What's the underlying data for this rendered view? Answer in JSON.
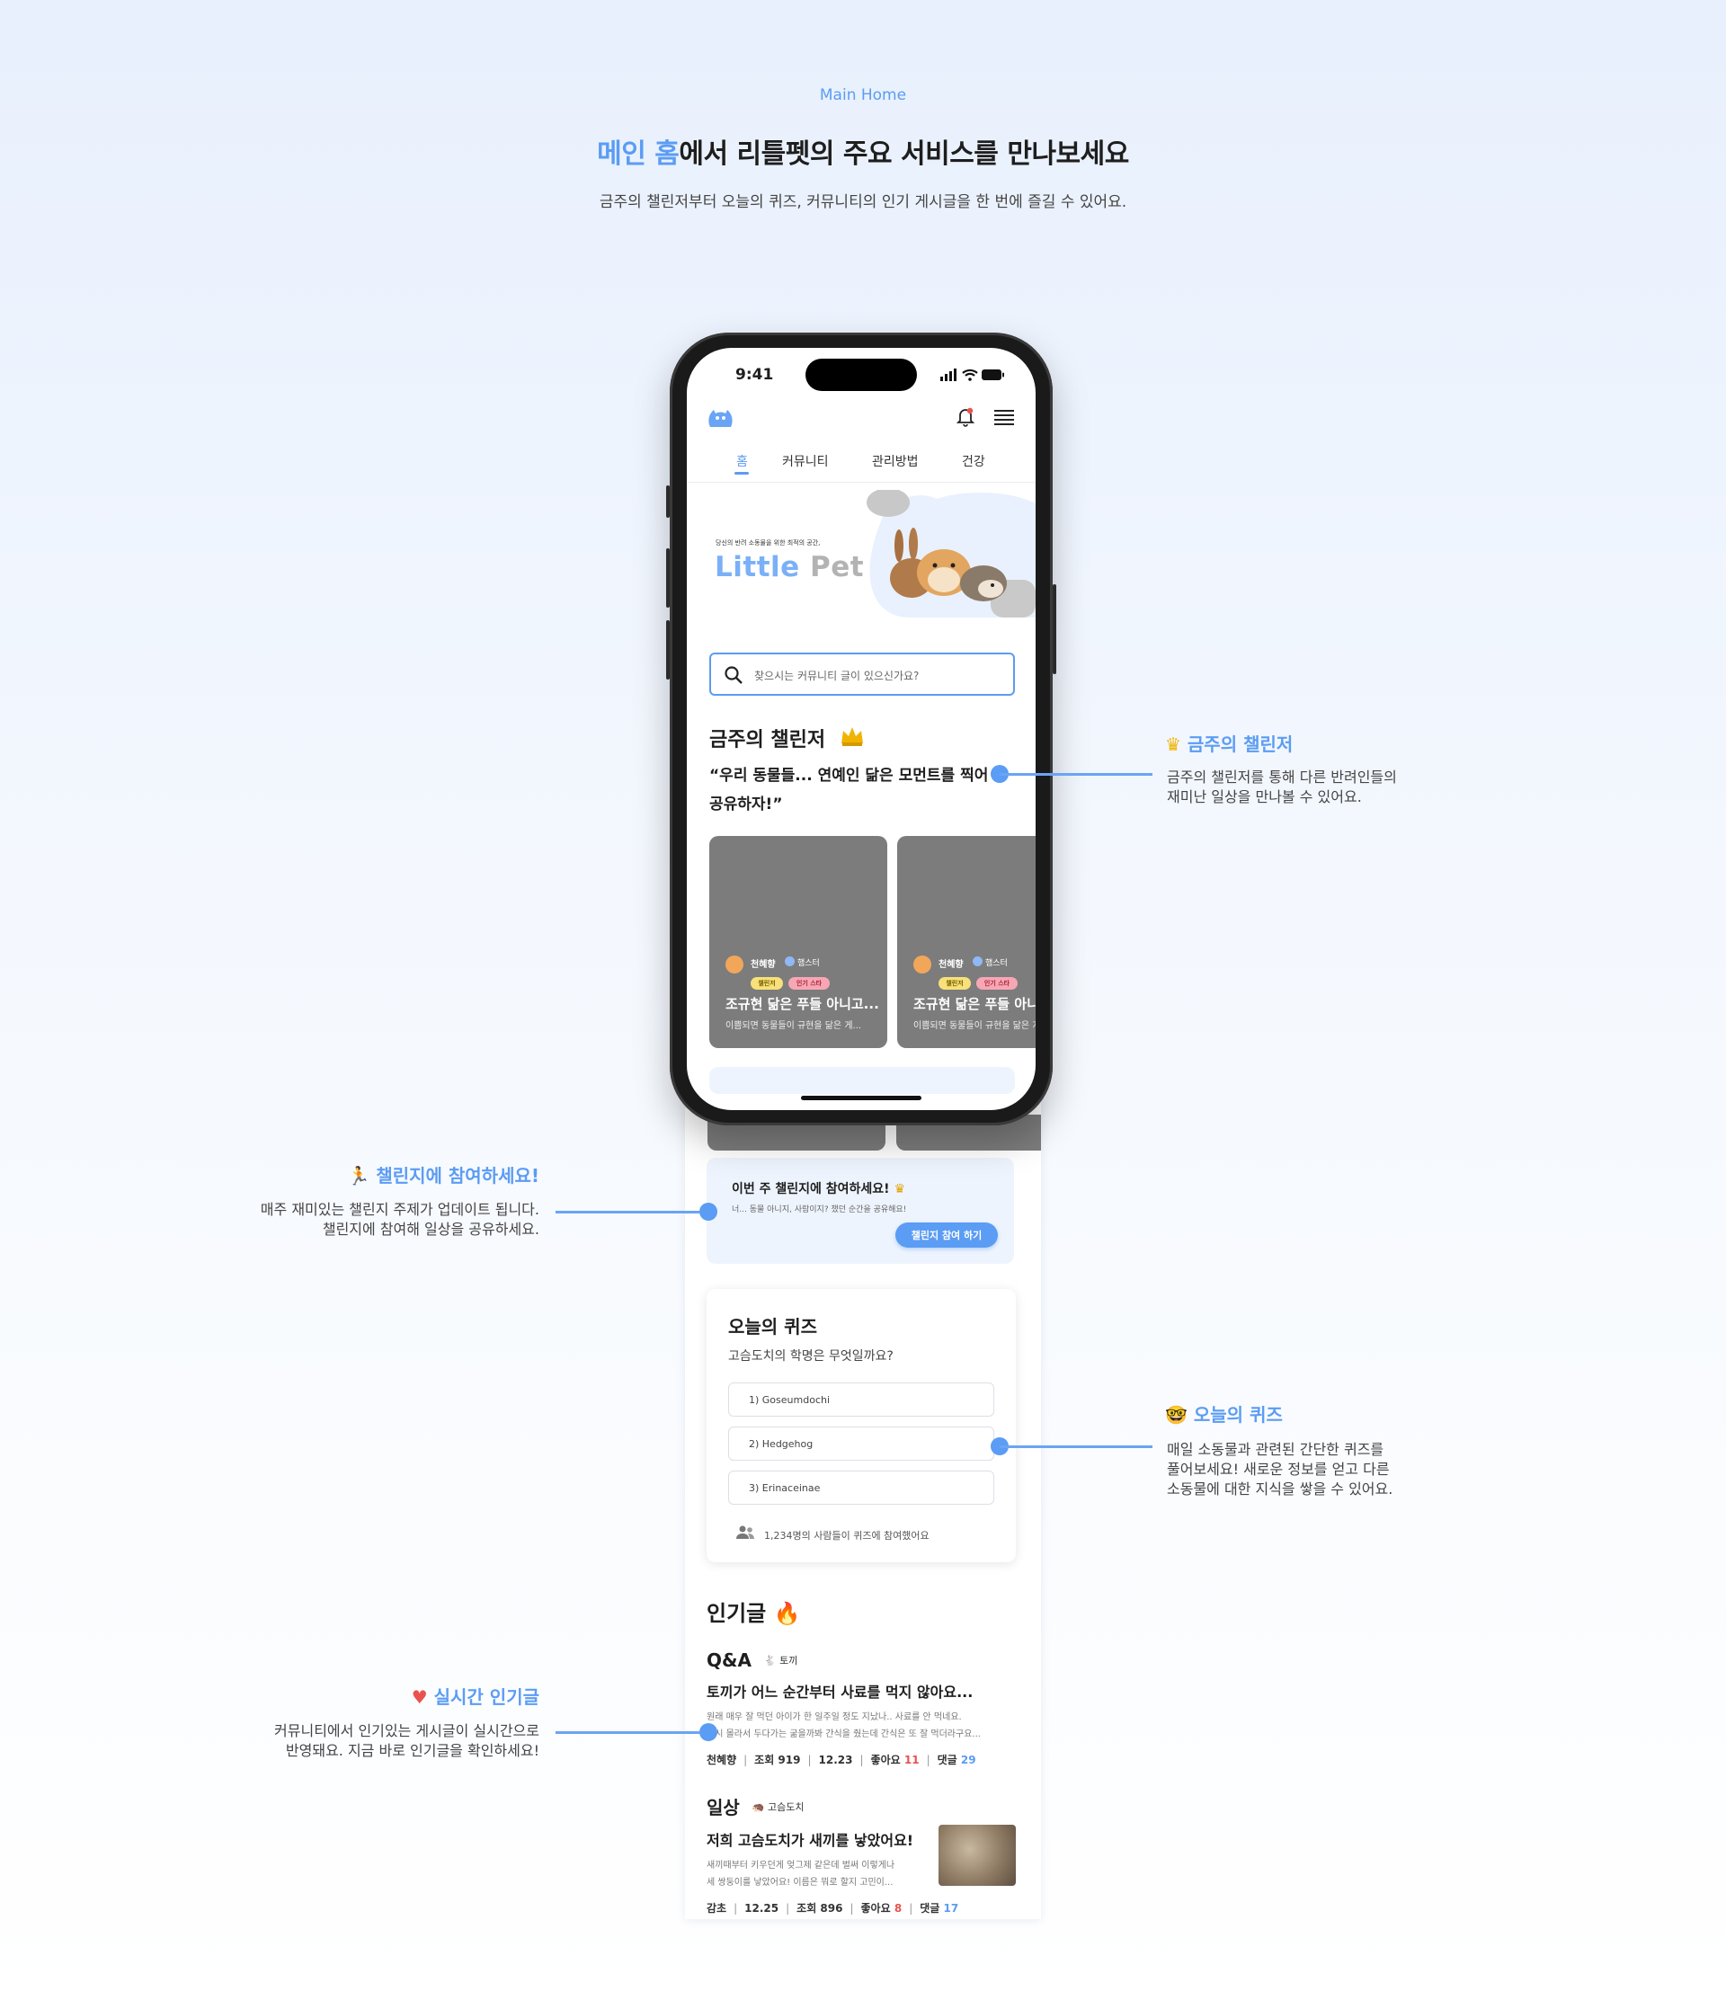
{
  "header": {
    "eyebrow": "Main Home",
    "headline_highlight": "메인 홈",
    "headline_rest": "에서 리틀펫의 주요 서비스를 만나보세요",
    "subline": "금주의 챌린저부터 오늘의 퀴즈, 커뮤니티의 인기 게시글을 한 번에 즐길 수 있어요."
  },
  "status_bar": {
    "time": "9:41"
  },
  "tabs": [
    {
      "label": "홈",
      "active": true
    },
    {
      "label": "커뮤니티",
      "active": false
    },
    {
      "label": "관리방법",
      "active": false
    },
    {
      "label": "건강",
      "active": false
    }
  ],
  "hero": {
    "tagline": "당신의 반려 소동물을 위한 최적의 공간,",
    "logo_part1": "Little",
    "logo_part2": "Pet"
  },
  "search": {
    "placeholder": "찾으시는 커뮤니티 글이 있으신가요?"
  },
  "challenger": {
    "title": "금주의 챌린저",
    "quote": "“우리 동물들... 연예인 닮은 모먼트를 찍어 공유하자!”",
    "cards": [
      {
        "author": "천혜향",
        "species": "햄스터",
        "badge1": "챌린저",
        "badge2": "인기 스타",
        "title": "조규현 닮은 푸들 아니고...",
        "snippet": "이쁨되면 동물들이 규현을 닮은 게..."
      },
      {
        "author": "천혜향",
        "species": "햄스터",
        "badge1": "챌린저",
        "badge2": "인기 스타",
        "title": "조규현 닮은 푸들 아니고...",
        "snippet": "이쁨되면 동물들이 규현을 닮은 게..."
      }
    ]
  },
  "challenge_cta": {
    "title": "이번 주 챌린지에 참여하세요!",
    "subtitle": "너... 동물 아니지, 사람이지? 챘던 순간을 공유해요!",
    "button": "챌린지 참여 하기"
  },
  "quiz": {
    "title": "오늘의 퀴즈",
    "question": "고슴도치의 학명은 무엇일까요?",
    "options": [
      "1) Goseumdochi",
      "2) Hedgehog",
      "3) Erinaceinae"
    ],
    "participants": "1,234명의 사람들이 퀴즈에 참여했어요"
  },
  "popular": {
    "title": "인기글",
    "posts": [
      {
        "category": "Q&A",
        "tag": "토끼",
        "title": "토끼가 어느 순간부터 사료를 먹지 않아요...",
        "body1": "원래 매우 잘 먹던 아이가 한 일주일 정도 지났나.. 사료를 안 먹네요.",
        "body2": "혹시 몰라서 두다가는 굶을까봐 간식을 줬는데 간식은 또 잘 먹더라구요...",
        "author": "천혜향",
        "views": "조회 919",
        "date": "12.23",
        "likes_label": "좋아요",
        "likes": "11",
        "comments_label": "댓글",
        "comments": "29"
      },
      {
        "category": "일상",
        "tag": "고슴도치",
        "title": "저희 고슴도치가 새끼를 낳았어요!",
        "body1": "새끼때부터 키우던게 엊그제 같은데 벌써 이렇게나",
        "body2": "세 쌍둥이를 낳았어요! 이름은 뭐로 할지 고민이...",
        "author": "감초",
        "date": "12.25",
        "views": "조회 896",
        "likes_label": "좋아요",
        "likes": "8",
        "comments_label": "댓글",
        "comments": "17"
      }
    ]
  },
  "annotations": {
    "challenger": {
      "title": "금주의 챌린저",
      "desc1": "금주의 챌린저를 통해 다른 반려인들의",
      "desc2": "재미난 일상을 만나볼 수 있어요."
    },
    "join": {
      "title": "챌린지에 참여하세요!",
      "desc1": "매주 재미있는 챌린지 주제가 업데이트 됩니다.",
      "desc2": "챌린지에 참여해 일상을 공유하세요."
    },
    "quiz": {
      "title": "오늘의 퀴즈",
      "desc1": "매일 소동물과 관련된 간단한 퀴즈를",
      "desc2": "풀어보세요! 새로운 정보를 얻고 다른",
      "desc3": "소동물에 대한 지식을 쌓을 수 있어요."
    },
    "popular": {
      "title": "실시간 인기글",
      "desc1": "커뮤니티에서 인기있는 게시글이 실시간으로",
      "desc2": "반영돼요. 지금 바로 인기글을 확인하세요!"
    }
  },
  "colors": {
    "accent": "#5b9cf4",
    "card_gray": "#7c7c7c",
    "like_red": "#e9534f"
  }
}
